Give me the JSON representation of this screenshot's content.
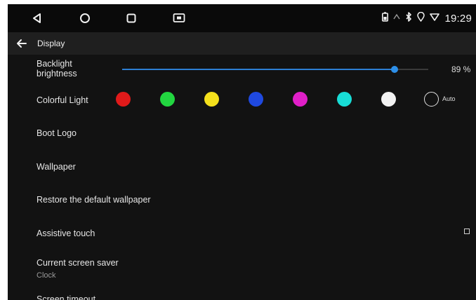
{
  "status_bar": {
    "nav_buttons": [
      "back-triangle-icon",
      "home-circle-icon",
      "recents-square-icon",
      "screenshot-icon"
    ],
    "status_icons": [
      "battery-icon",
      "signal-icon",
      "bluetooth-icon",
      "location-icon",
      "wifi-icon"
    ],
    "clock": "19:29"
  },
  "app_bar": {
    "title": "Display"
  },
  "settings": {
    "backlight_label": "Backlight\nbrightness",
    "brightness_percent": 89,
    "brightness_text": "89 %",
    "colorful_light_label": "Colorful Light",
    "colors": [
      "#e01a1a",
      "#22d640",
      "#f4e01c",
      "#1f49e0",
      "#e01fc8",
      "#18ddd6",
      "#f2f2f2"
    ],
    "auto_label": "Auto",
    "boot_logo_label": "Boot Logo",
    "wallpaper_label": "Wallpaper",
    "restore_label": "Restore the default wallpaper",
    "assistive_touch_label": "Assistive touch",
    "assistive_touch_checked": false,
    "screen_saver_label": "Current screen saver",
    "screen_saver_value": "Clock",
    "screen_timeout_label": "Screen timeout"
  },
  "accent_color": "#2d7fd3"
}
